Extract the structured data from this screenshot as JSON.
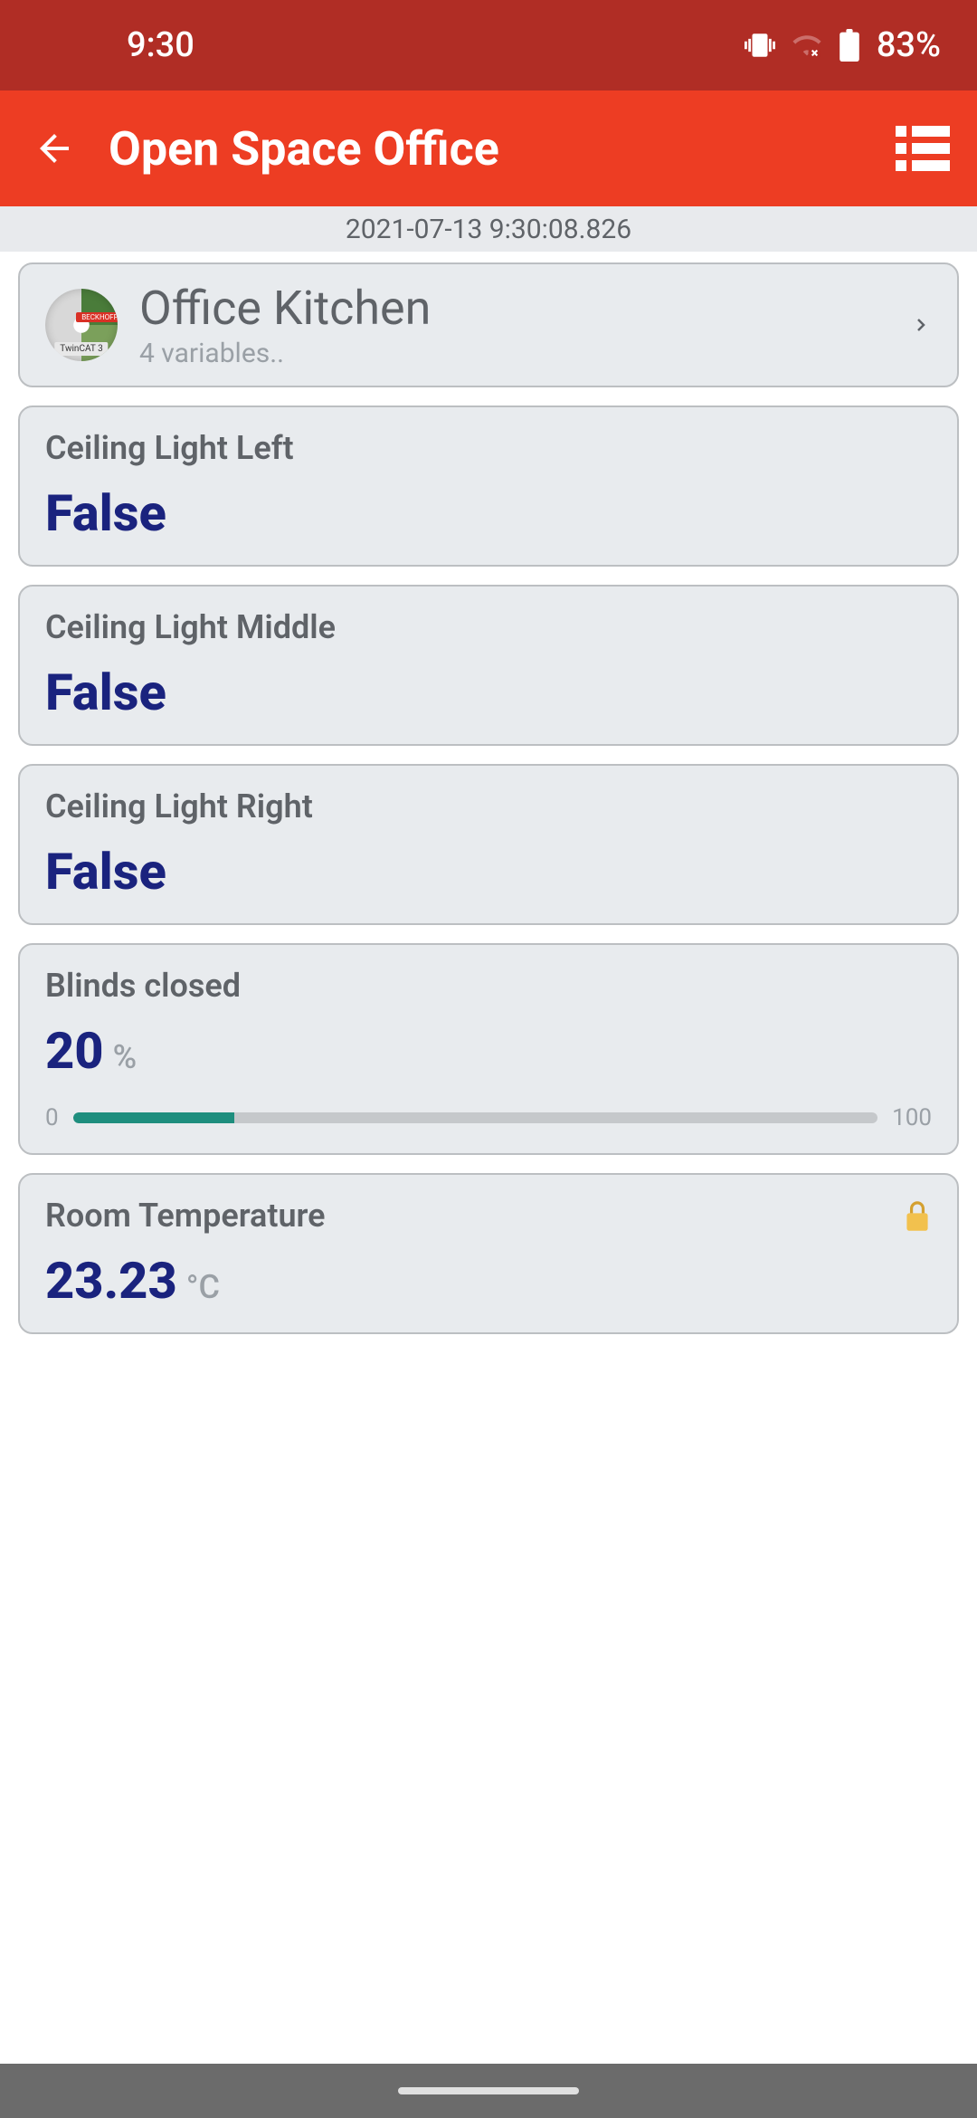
{
  "status": {
    "time": "9:30",
    "battery": "83%"
  },
  "header": {
    "title": "Open Space Office"
  },
  "timestamp": "2021-07-13 9:30:08.826",
  "summary": {
    "title": "Office Kitchen",
    "subtitle": "4  variables.."
  },
  "cards": {
    "ceiling_left": {
      "label": "Ceiling Light Left",
      "value": "False"
    },
    "ceiling_middle": {
      "label": "Ceiling Light Middle",
      "value": "False"
    },
    "ceiling_right": {
      "label": "Ceiling Light Right",
      "value": "False"
    },
    "blinds": {
      "label": "Blinds closed",
      "value": "20",
      "unit": "%",
      "min": "0",
      "max": "100",
      "percent": 20
    },
    "temperature": {
      "label": "Room Temperature",
      "value": "23.23",
      "unit": "°C"
    }
  }
}
